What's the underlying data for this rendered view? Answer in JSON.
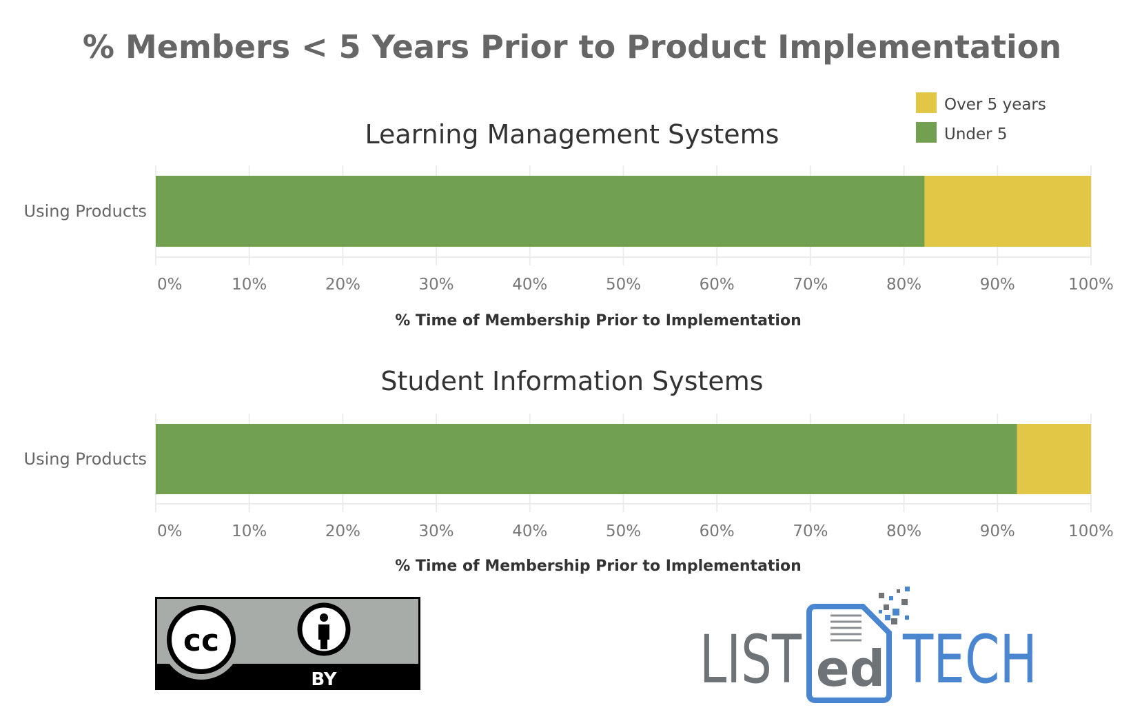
{
  "chart_data": [
    {
      "type": "bar",
      "orientation": "horizontal",
      "stacked": true,
      "title": "Learning Management Systems",
      "categories": [
        "Using Products"
      ],
      "series": [
        {
          "name": "Under 5",
          "values": [
            82.2
          ],
          "color": "#70A050"
        },
        {
          "name": "Over 5 years",
          "values": [
            17.8
          ],
          "color": "#E2C646"
        }
      ],
      "xlabel": "% Time of Membership Prior to Implementation",
      "ylabel": "",
      "xlim": [
        0,
        100
      ],
      "xticks": [
        "0%",
        "10%",
        "20%",
        "30%",
        "40%",
        "50%",
        "60%",
        "70%",
        "80%",
        "90%",
        "100%"
      ],
      "grid": true
    },
    {
      "type": "bar",
      "orientation": "horizontal",
      "stacked": true,
      "title": "Student Information Systems",
      "categories": [
        "Using Products"
      ],
      "series": [
        {
          "name": "Under 5",
          "values": [
            92.1
          ],
          "color": "#70A050"
        },
        {
          "name": "Over 5 years",
          "values": [
            7.9
          ],
          "color": "#E2C646"
        }
      ],
      "xlabel": "% Time of Membership Prior to Implementation",
      "ylabel": "",
      "xlim": [
        0,
        100
      ],
      "xticks": [
        "0%",
        "10%",
        "20%",
        "30%",
        "40%",
        "50%",
        "60%",
        "70%",
        "80%",
        "90%",
        "100%"
      ],
      "grid": true
    }
  ],
  "main_title": "% Members < 5 Years Prior to Product Implementation",
  "legend": {
    "placement": "top-right",
    "items": [
      {
        "label": "Over 5 years",
        "color": "#E2C646"
      },
      {
        "label": "Under 5",
        "color": "#70A050"
      }
    ]
  },
  "license_badge": {
    "text_cc": "cc",
    "text_by": "BY"
  },
  "brand_logo": {
    "part1": "LIST",
    "part2": "ed",
    "part3": "TECH",
    "grey": "#6E7378",
    "blue": "#4A86D0"
  }
}
